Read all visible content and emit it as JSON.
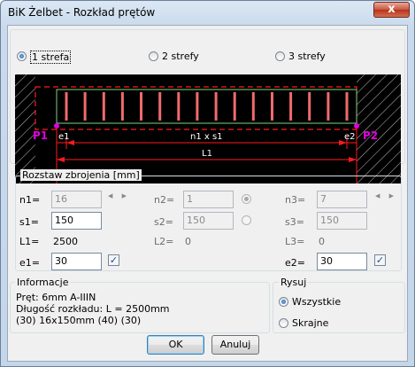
{
  "window": {
    "title": "BiK Żelbet - Rozkład prętów",
    "close_label": "x"
  },
  "zones": {
    "options": [
      {
        "label": "1 strefa",
        "selected": true
      },
      {
        "label": "2 strefy",
        "selected": false
      },
      {
        "label": "3 strefy",
        "selected": false
      }
    ]
  },
  "diagram": {
    "p1": "P1",
    "p2": "P2",
    "e1": "e1",
    "e2": "e2",
    "middle": "n1 x s1",
    "total": "L1",
    "bar_count": 16
  },
  "spacing": {
    "group_title": "Rozstaw zbrojenia [mm]",
    "n1_label": "n1=",
    "n1_value": "16",
    "s1_label": "s1=",
    "s1_value": "150",
    "L1_label": "L1=",
    "L1_value": "2500",
    "e1_label": "e1=",
    "e1_value": "30",
    "e1_checked": true,
    "n2_label": "n2=",
    "n2_value": "1",
    "s2_label": "s2=",
    "s2_value": "150",
    "L2_label": "L2=",
    "L2_value": "0",
    "n3_label": "n3=",
    "n3_value": "7",
    "s3_label": "s3=",
    "s3_value": "150",
    "L3_label": "L3=",
    "L3_value": "0",
    "e2_label": "e2=",
    "e2_value": "30",
    "e2_checked": true
  },
  "info": {
    "group_title": "Informacje",
    "line1": "Pręt:   6mm   A-IIIN",
    "line2": "Długość rozkładu:   L = 2500mm",
    "line3": "(30) 16x150mm (40) (30)"
  },
  "draw": {
    "group_title": "Rysuj",
    "options": [
      {
        "label": "Wszystkie",
        "selected": true
      },
      {
        "label": "Skrajne",
        "selected": false
      }
    ]
  },
  "buttons": {
    "ok": "OK",
    "cancel": "Anuluj"
  },
  "colors": {
    "bar": "#ef6b6b",
    "dim_red": "#ff1a1a",
    "label_magenta": "#e000e0",
    "outline_green": "#7fd27f"
  }
}
